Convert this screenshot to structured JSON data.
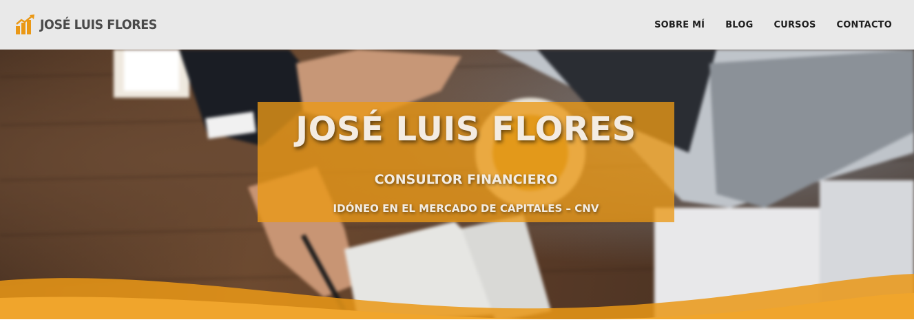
{
  "header": {
    "brand_name": "JOSÉ LUIS FLORES",
    "logo_icon": "bar-chart-arrow-icon",
    "nav": [
      {
        "label": "SOBRE MÍ"
      },
      {
        "label": "BLOG"
      },
      {
        "label": "CURSOS"
      },
      {
        "label": "CONTACTO"
      }
    ]
  },
  "hero": {
    "title": "JOSÉ LUIS FLORES",
    "subtitle": "CONSULTOR FINANCIERO",
    "tagline": "IDÓNEO EN EL MERCADO DE CAPITALES – CNV"
  },
  "colors": {
    "accent": "#ea9816",
    "header_bg": "#e9e9e9",
    "nav_text": "#1f1f1f",
    "brand_text": "#4a4a4a"
  }
}
